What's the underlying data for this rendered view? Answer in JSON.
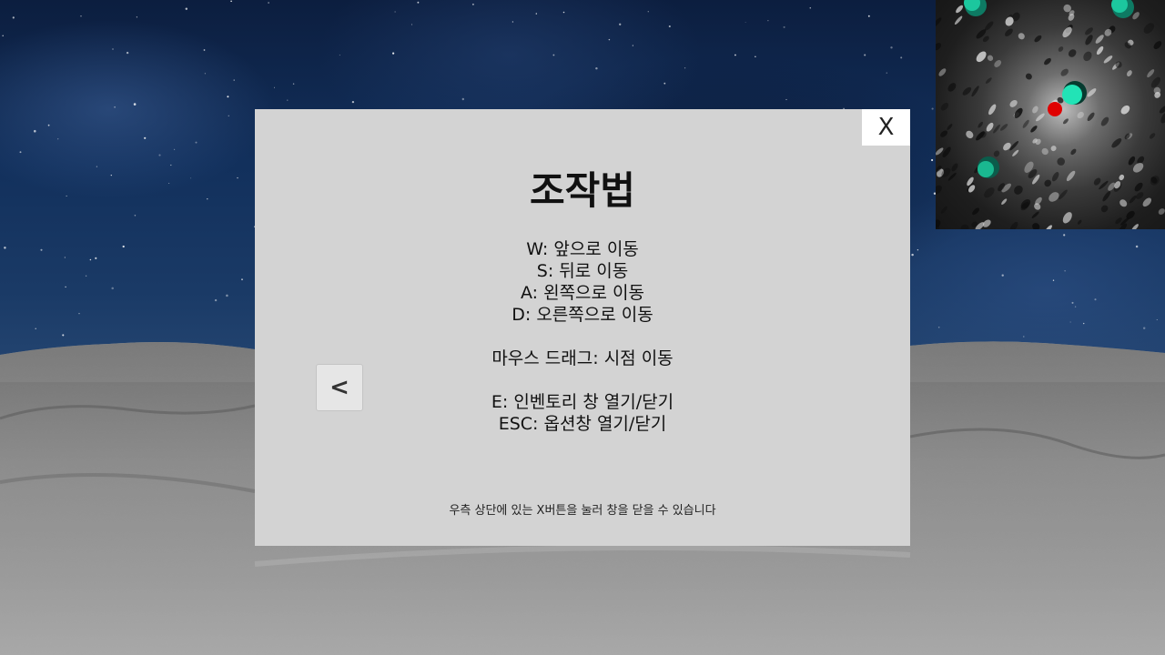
{
  "dialog": {
    "close_label": "X",
    "title": "조작법",
    "controls": [
      "W: 앞으로 이동",
      "S: 뒤로 이동",
      "A: 왼쪽으로 이동",
      "D: 오른쪽으로 이동",
      "",
      "마우스 드래그: 시점 이동",
      "",
      "E: 인벤토리 창 열기/닫기",
      "ESC: 옵션창 열기/닫기"
    ],
    "prev_label": "<",
    "footer_hint": "우측 상단에 있는 X버튼을 눌러 창을 닫을 수 있습니다"
  },
  "colors": {
    "dialog_bg": "#d3d3d3",
    "close_button_bg": "#ffffff",
    "minimap_player": "#e00000",
    "minimap_objects": "#19c9a0"
  },
  "icons": {
    "player_marker": "red-dot-icon",
    "object_marker": "teal-sphere-icon"
  }
}
